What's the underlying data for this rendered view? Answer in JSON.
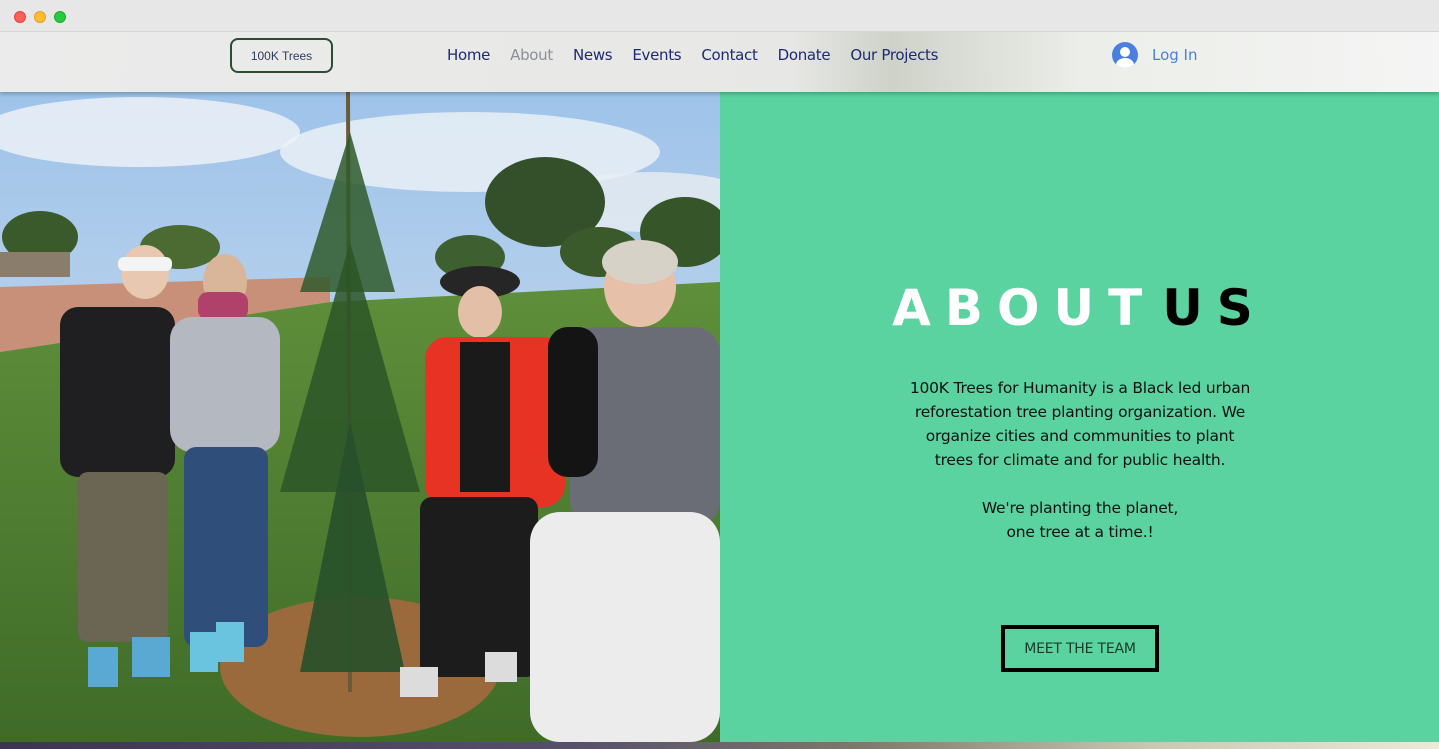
{
  "header": {
    "brand_label": "100K Trees",
    "nav": [
      {
        "label": "Home",
        "active": false
      },
      {
        "label": "About",
        "active": true
      },
      {
        "label": "News",
        "active": false
      },
      {
        "label": "Events",
        "active": false
      },
      {
        "label": "Contact",
        "active": false
      },
      {
        "label": "Donate",
        "active": false
      },
      {
        "label": "Our Projects",
        "active": false
      }
    ],
    "login_label": "Log In",
    "login_icon": "user-avatar-icon"
  },
  "about": {
    "title_part1": "ABOUT",
    "title_part2": "US",
    "paragraph1": "100K Trees for Humanity is a Black led urban reforestation tree planting organization. We organize cities and communities to plant trees for climate and for public health.",
    "paragraph2_line1": "We're planting the planet,",
    "paragraph2_line2": "one tree at a time.!",
    "button_label": "MEET THE TEAM"
  },
  "colors": {
    "about_bg": "#5bd3a0",
    "nav_text": "#1d2a73",
    "nav_active": "#8b8f99",
    "login_blue": "#4a7fe0"
  }
}
